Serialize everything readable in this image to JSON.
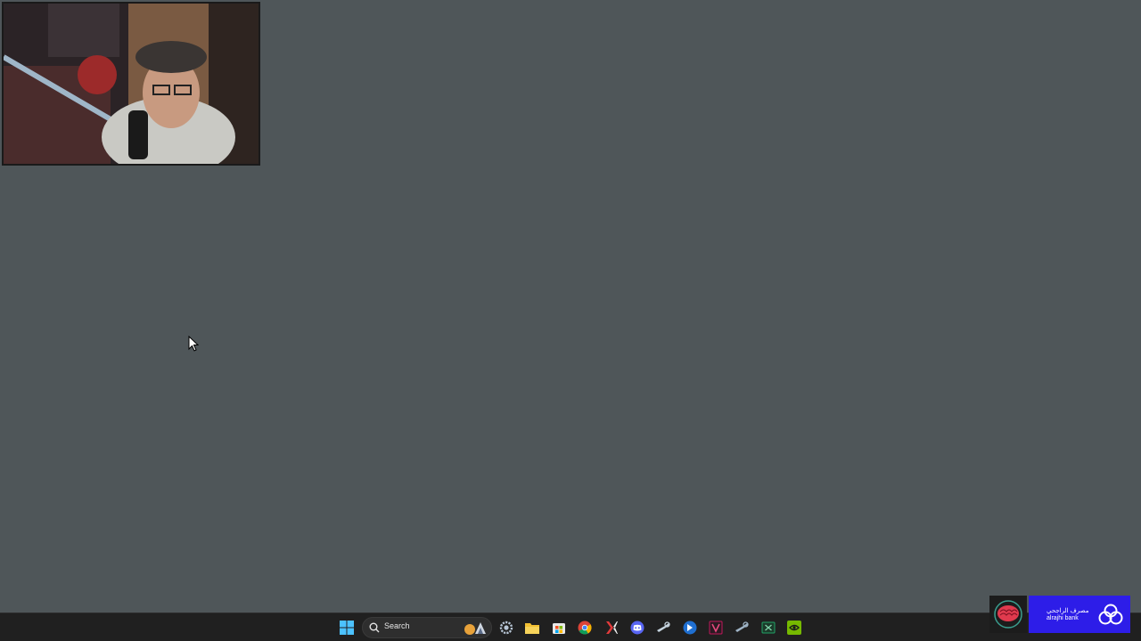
{
  "desktop": {
    "background_color": "#4f5659"
  },
  "webcam": {
    "content": "webcam-feed"
  },
  "taskbar": {
    "search": {
      "label": "Search"
    },
    "icons": [
      "start-icon",
      "settings-icon",
      "file-explorer-icon",
      "store-icon",
      "chrome-icon",
      "app-x-icon",
      "discord-icon",
      "steam-icon",
      "app-arrow-icon",
      "app-v-icon",
      "steam-icon",
      "excel-icon",
      "nvidia-icon"
    ]
  },
  "sponsor": {
    "brand_en": "alrajhi bank",
    "brand_ar": "مصرف الراجحي",
    "color": "#2d1de8"
  }
}
